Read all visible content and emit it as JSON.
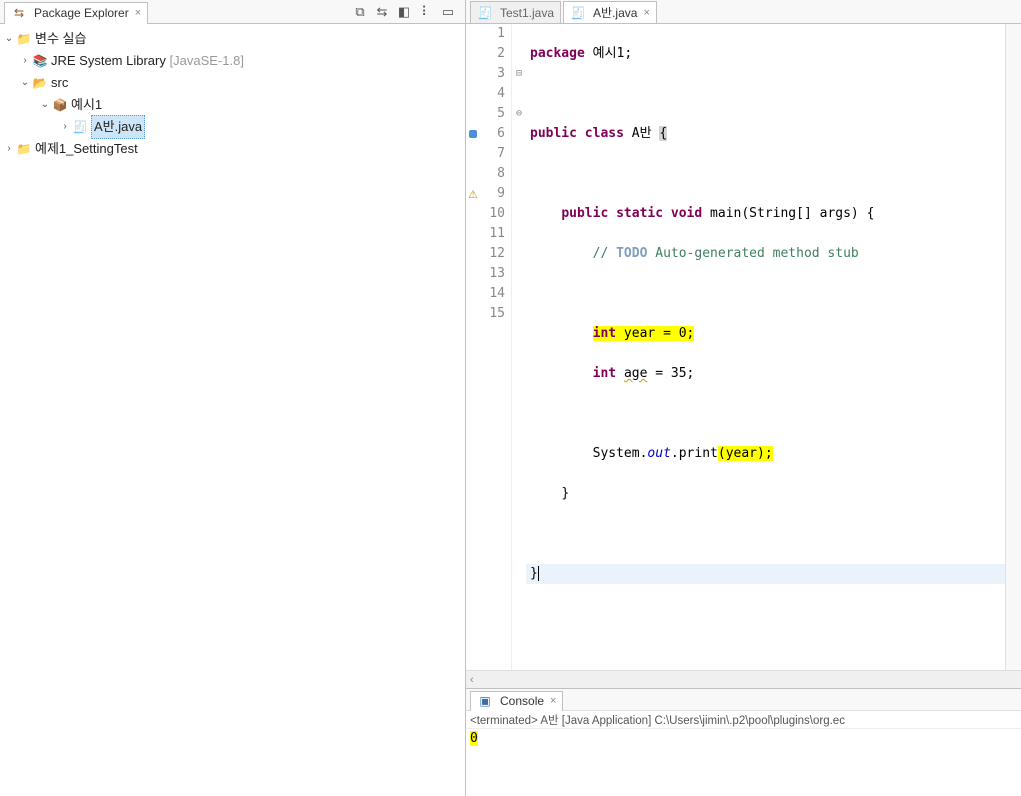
{
  "explorer": {
    "title": "Package Explorer",
    "toolbar_icons": [
      "link-with-editor-icon",
      "view-menu-icon",
      "minimize-icon",
      "maximize-icon"
    ],
    "tree": {
      "project1": {
        "name": "변수 실습",
        "jre": {
          "label": "JRE System Library",
          "env": "[JavaSE-1.8]"
        },
        "src": "src",
        "pkg": "예시1",
        "file": "A반.java"
      },
      "project2": {
        "name": "예제1_SettingTest"
      }
    }
  },
  "editor": {
    "tabs": [
      {
        "label": "Test1.java"
      },
      {
        "label": "A반.java",
        "active": true
      }
    ],
    "lines": {
      "l1_a": "package",
      "l1_b": " 예시1;",
      "l3_a": "public",
      "l3_b": " class",
      "l3_c": " A반 ",
      "l3_d": "{",
      "l5_a": "public",
      "l5_b": " static",
      "l5_c": " void",
      "l5_d": " main(String[] args) {",
      "l6_a": "// ",
      "l6_b": "TODO",
      "l6_c": " Auto-generated method stub",
      "l8_a": "int",
      "l8_b": " year = 0;",
      "l9_a": "int",
      "l9_b": " age = 35;",
      "l11_a": "System.",
      "l11_b": "out",
      "l11_c": ".print",
      "l11_d": "(year);",
      "l12": "}",
      "l14": "}"
    },
    "line_numbers": [
      "1",
      "2",
      "3",
      "4",
      "5",
      "6",
      "7",
      "8",
      "9",
      "10",
      "11",
      "12",
      "13",
      "14",
      "15"
    ]
  },
  "console": {
    "title": "Console",
    "status_prefix": "<terminated>",
    "status_text": " A반 [Java Application] C:\\Users\\jimin\\.p2\\pool\\plugins\\org.ec",
    "output": "0"
  }
}
